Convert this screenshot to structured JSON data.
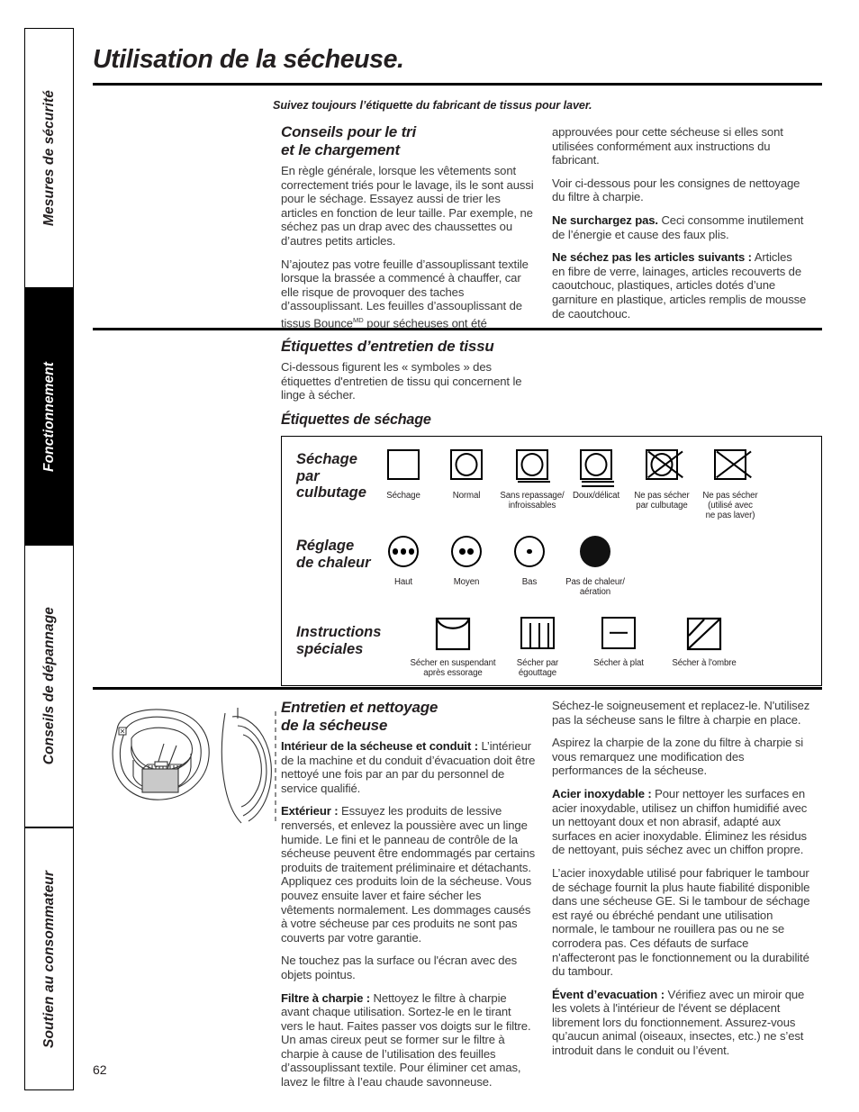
{
  "sidebar": {
    "items": [
      {
        "label": "Mesures de sécurité",
        "active": false
      },
      {
        "label": "Fonctionnement",
        "active": true
      },
      {
        "label": "Conseils de dépannage",
        "active": false
      },
      {
        "label": "Soutien au consommateur",
        "active": false
      }
    ]
  },
  "header": {
    "title": "Utilisation de la sécheuse.",
    "subtitle": "Suivez toujours l’étiquette du fabricant de tissus pour laver."
  },
  "section_sorting": {
    "heading": "Conseils pour le tri\net le chargement",
    "left_paragraphs": [
      "En règle générale, lorsque les vêtements sont correctement triés pour le lavage, ils le sont aussi pour le séchage. Essayez aussi de trier les articles en fonction de leur taille. Par exemple, ne séchez pas un drap avec des chaussettes ou d’autres petits articles.",
      "N’ajoutez pas votre feuille d’assouplissant textile lorsque la brassée a commencé à chauffer, car elle risque de provoquer des taches d’assouplissant. Les feuilles d’assouplissant de tissus Bounce"
    ],
    "bounce_sup": "MD",
    "bounce_tail": " pour sécheuses ont été",
    "right_paragraphs": [
      "approuvées pour cette sécheuse si elles sont utilisées conformément aux instructions du fabricant.",
      "Voir ci-dessous pour les consignes de nettoyage du filtre à charpie."
    ],
    "right_bold_1": "Ne surchargez pas.",
    "right_text_1": " Ceci consomme inutilement de l’énergie et cause des faux plis.",
    "right_bold_2": "Ne séchez pas les articles suivants :",
    "right_text_2": " Articles en fibre de verre, lainages, articles recouverts de caoutchouc, plastiques, articles dotés d’une garniture en plastique, articles remplis de mousse de caoutchouc."
  },
  "section_labels": {
    "heading": "Étiquettes d’entretien de tissu",
    "intro": "Ci-dessous figurent les « symboles » des étiquettes d'entretien de tissu qui concernent le linge à sécher.",
    "subheading": "Étiquettes de séchage"
  },
  "symbols": {
    "rows": [
      {
        "title": "Séchage\npar\nculbutage",
        "items": [
          {
            "icon": "square-icon",
            "caption": "Séchage"
          },
          {
            "icon": "circle-in-square-icon",
            "caption": "Normal"
          },
          {
            "icon": "circle-in-square-one-bar-icon",
            "caption": "Sans repassage/\ninfroissables"
          },
          {
            "icon": "circle-in-square-two-bars-icon",
            "caption": "Doux/délicat"
          },
          {
            "icon": "crossed-circle-in-square-icon",
            "caption": "Ne pas sécher\npar culbutage"
          },
          {
            "icon": "crossed-square-icon",
            "caption": "Ne pas sécher\n(utilisé avec\nne pas laver)"
          }
        ]
      },
      {
        "title": "Réglage\nde chaleur",
        "items": [
          {
            "icon": "circle-three-dots-icon",
            "caption": "Haut"
          },
          {
            "icon": "circle-two-dots-icon",
            "caption": "Moyen"
          },
          {
            "icon": "circle-one-dot-icon",
            "caption": "Bas"
          },
          {
            "icon": "filled-circle-icon",
            "caption": "Pas de chaleur/\naération"
          }
        ]
      },
      {
        "title": "Instructions\nspéciales",
        "items": [
          {
            "icon": "hang-dry-icon",
            "caption": "Sécher en suspendant\naprès essorage"
          },
          {
            "icon": "drip-dry-icon",
            "caption": "Sécher par\négouttage"
          },
          {
            "icon": "flat-dry-icon",
            "caption": "Sécher à plat"
          },
          {
            "icon": "shade-dry-icon",
            "caption": "Sécher à l'ombre"
          }
        ]
      }
    ]
  },
  "section_care": {
    "heading": "Entretien et nettoyage\nde la sécheuse",
    "left": {
      "bold_1": "Intérieur de la sécheuse et conduit :",
      "text_1": " L’intérieur de la machine et du conduit d’évacuation doit être nettoyé une fois par an par du personnel de service qualifié.",
      "bold_2": "Extérieur :",
      "text_2": " Essuyez les produits de lessive renversés, et enlevez la poussière avec un linge humide. Le fini et le panneau de contrôle de la sécheuse peuvent être endommagés par certains produits de traitement préliminaire et détachants. Appliquez ces produits loin de la sécheuse. Vous pouvez ensuite laver et faire sécher les vêtements normalement. Les dommages causés à votre sécheuse par ces produits ne sont pas couverts par votre garantie.",
      "text_3": "Ne touchez pas la surface ou l'écran avec des objets pointus.",
      "bold_4": "Filtre à charpie :",
      "text_4": " Nettoyez le filtre à charpie avant chaque utilisation. Sortez-le en le tirant vers le haut. Faites passer vos doigts sur le filtre. Un amas cireux peut se former sur le filtre à charpie à cause de l’utilisation des feuilles d’assouplissant textile. Pour éliminer cet amas, lavez le filtre à l’eau chaude savonneuse."
    },
    "right": {
      "text_1": "Séchez-le soigneusement et replacez-le. N'utilisez pas la sécheuse sans le filtre à charpie en place.",
      "text_2": "Aspirez la charpie de la zone du filtre à charpie si vous remarquez une modification des performances de la sécheuse.",
      "bold_3": "Acier inoxydable :",
      "text_3": " Pour nettoyer les surfaces en acier inoxydable, utilisez un chiffon humidifié avec un nettoyant doux et non abrasif, adapté aux surfaces en acier inoxydable. Éliminez les résidus de nettoyant, puis séchez avec un chiffon propre.",
      "text_4": "L’acier inoxydable utilisé pour fabriquer le tambour de séchage fournit la plus haute fiabilité disponible dans une sécheuse GE. Si le tambour de séchage est rayé ou ébréché pendant une utilisation normale, le tambour ne rouillera pas ou ne se corrodera pas. Ces défauts de surface n'affecteront pas le fonctionnement ou la durabilité du tambour.",
      "bold_5": "Évent d’evacuation :",
      "text_5": " Vérifiez avec un miroir que les volets à l'intérieur de l'évent se déplacent librement lors du fonctionnement. Assurez-vous qu’aucun animal (oiseaux, insectes, etc.) ne s’est introduit dans le conduit ou l’évent."
    }
  },
  "footer": {
    "page_number": "62"
  }
}
